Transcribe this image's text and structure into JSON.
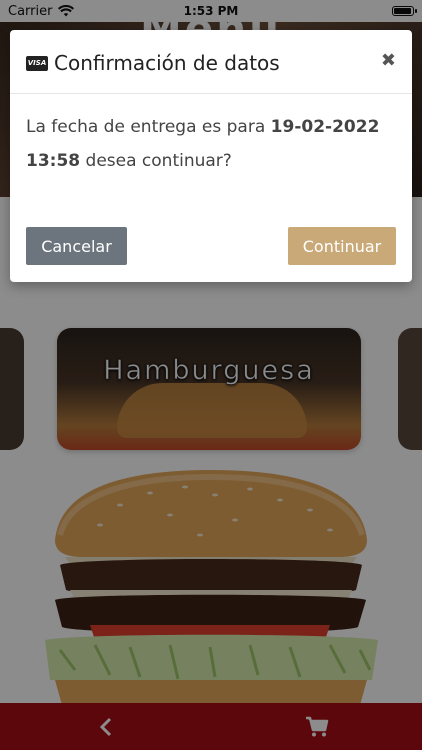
{
  "status_bar": {
    "carrier": "Carrier",
    "time": "1:53 PM",
    "battery_level": 1.0
  },
  "header": {
    "title": "Menú"
  },
  "carousel": {
    "active_category": "Hamburguesa"
  },
  "modal": {
    "title": "Confirmación de datos",
    "card_icon": "visa-card-icon",
    "close_icon": "close-icon",
    "message_prefix": "La fecha de entrega es para ",
    "date": "19-02-2022",
    "time": "13:58",
    "message_suffix": " desea continuar?",
    "cancel_label": "Cancelar",
    "continue_label": "Continuar"
  },
  "bottom_bar": {
    "back_icon": "chevron-left-icon",
    "cart_icon": "cart-icon"
  },
  "colors": {
    "brand_red": "#a70e15",
    "cancel_gray": "#6c757d",
    "continue_gold": "#c9a977"
  }
}
